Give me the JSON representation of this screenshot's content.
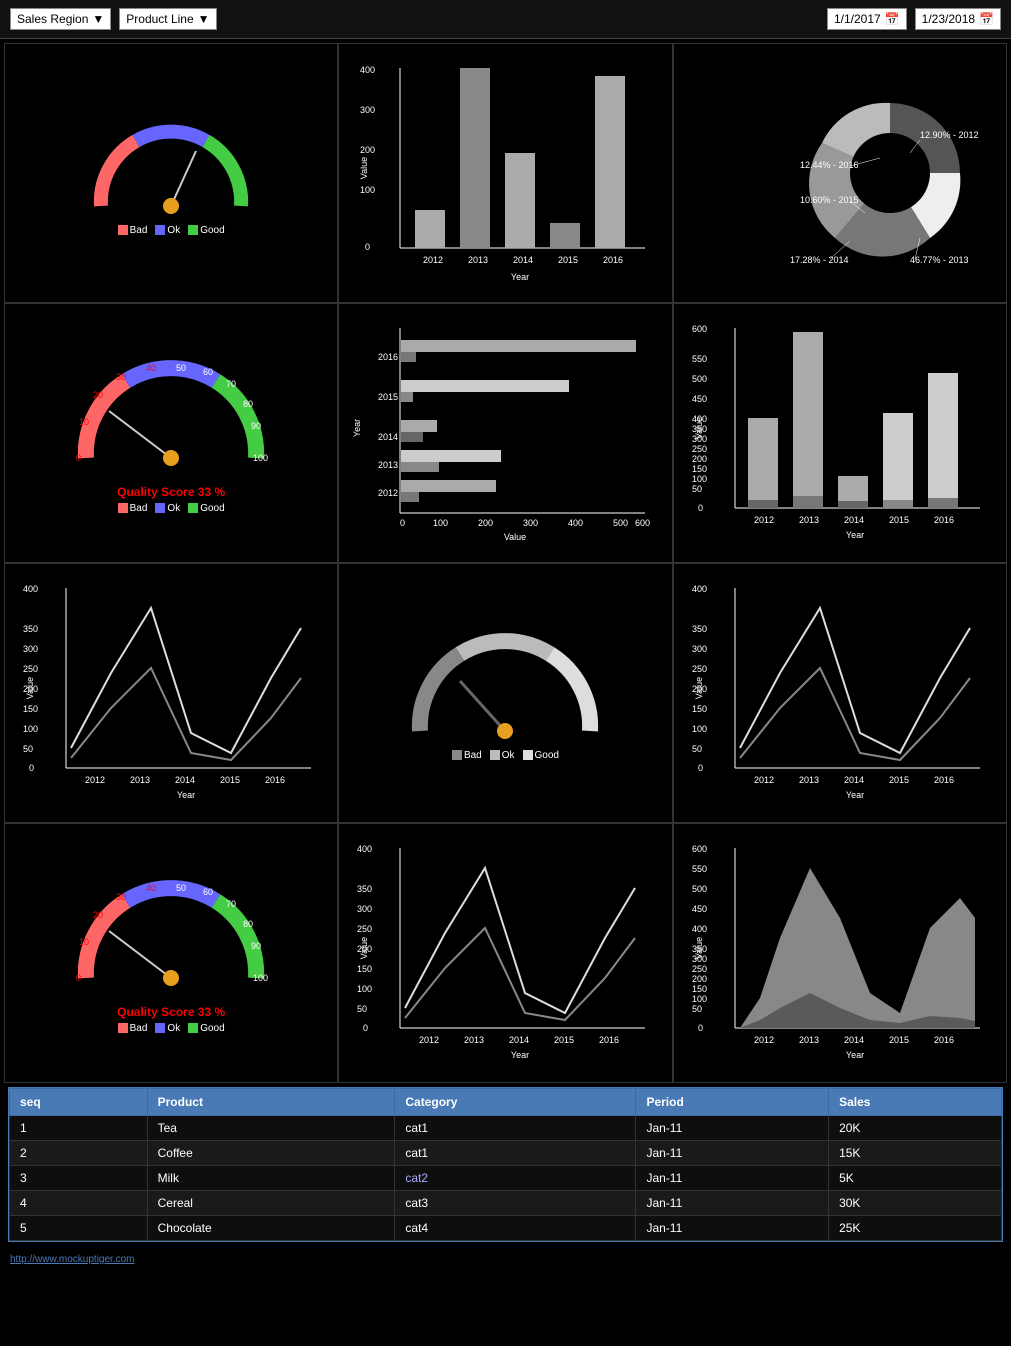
{
  "header": {
    "filter1_label": "Sales Region",
    "filter2_label": "Product Line",
    "date1": "1/1/2017",
    "date2": "1/23/2018"
  },
  "gauges": {
    "g1": {
      "score": null,
      "needle_angle": -30
    },
    "g2": {
      "score": "Quality Score 33 %",
      "needle_angle": -60
    },
    "g3": {
      "needle_angle": -30
    },
    "g4": {
      "score": "Quality Score 33 %",
      "needle_angle": -60
    }
  },
  "donut": {
    "segments": [
      {
        "label": "12.44% - 2016",
        "value": 12.44,
        "color": "#bbb"
      },
      {
        "label": "12.90% - 2012",
        "value": 12.9,
        "color": "#eee"
      },
      {
        "label": "10.60% - 2015",
        "value": 10.6,
        "color": "#999"
      },
      {
        "label": "46.77% - 2013",
        "value": 46.77,
        "color": "#555"
      },
      {
        "label": "17.28% - 2014",
        "value": 17.28,
        "color": "#777"
      }
    ]
  },
  "bar_chart1": {
    "title_y": "Value",
    "title_x": "Year",
    "years": [
      "2012",
      "2013",
      "2014",
      "2015",
      "2016"
    ],
    "values": [
      80,
      420,
      200,
      60,
      360
    ]
  },
  "bar_chart2": {
    "title_y": "Year",
    "title_x": "Value",
    "years": [
      "2016",
      "2015",
      "2014",
      "2013",
      "2012"
    ],
    "values": [
      520,
      370,
      80,
      220,
      210
    ],
    "values2": [
      30,
      20,
      50,
      80,
      40
    ]
  },
  "bar_chart3": {
    "title_y": "Value",
    "title_x": "Year",
    "years": [
      "2012",
      "2013",
      "2014",
      "2015",
      "2016"
    ],
    "values": [
      280,
      570,
      90,
      350,
      440
    ],
    "values2": [
      30,
      50,
      40,
      20,
      35
    ]
  },
  "line_chart1": {
    "title_y": "Value",
    "title_x": "Year"
  },
  "line_chart2": {
    "title_y": "Value",
    "title_x": "Year"
  },
  "line_chart3": {
    "title_y": "Value",
    "title_x": "Year"
  },
  "area_chart": {
    "title_y": "Value",
    "title_x": "Year"
  },
  "table": {
    "headers": [
      "seq",
      "Product",
      "Category",
      "Period",
      "Sales"
    ],
    "rows": [
      [
        "1",
        "Tea",
        "cat1",
        "Jan-11",
        "20K"
      ],
      [
        "2",
        "Coffee",
        "cat1",
        "Jan-11",
        "15K"
      ],
      [
        "3",
        "Milk",
        "cat2",
        "Jan-11",
        "5K"
      ],
      [
        "4",
        "Cereal",
        "cat3",
        "Jan-11",
        "30K"
      ],
      [
        "5",
        "Chocolate",
        "cat4",
        "Jan-11",
        "25K"
      ]
    ]
  },
  "footer": {
    "url": "http://www.mockuptiger.com"
  },
  "legend": {
    "bad": "Bad",
    "ok": "Ok",
    "good": "Good"
  }
}
